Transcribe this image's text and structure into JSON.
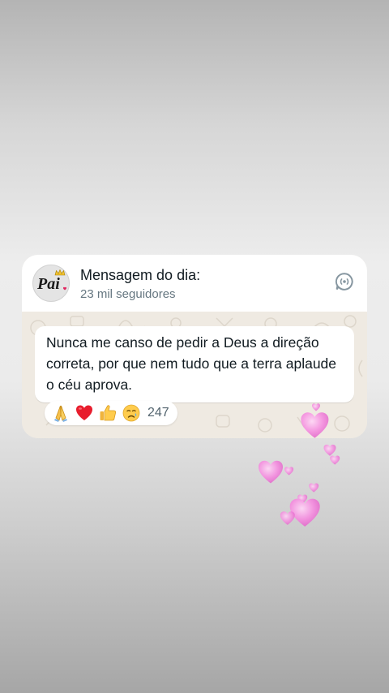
{
  "channel": {
    "name": "Mensagem do dia:",
    "followers": "23 mil seguidores",
    "avatar_text": "Pai",
    "avatar_icon": "crown-icon",
    "channel_icon": "channel-icon"
  },
  "message": {
    "text": "Nunca me canso de pedir a Deus a direção correta, por que nem tudo que a terra aplaude o céu aprova."
  },
  "reactions": {
    "emojis": [
      "folded-hands-icon",
      "red-heart-icon",
      "thumbs-up-icon",
      "crying-face-icon"
    ],
    "count": "247"
  },
  "colors": {
    "card_bg": "#ffffff",
    "chat_bg": "#efeae2",
    "text_primary": "#111b21",
    "text_secondary": "#667781",
    "heart_pink": "#f58fe0"
  }
}
